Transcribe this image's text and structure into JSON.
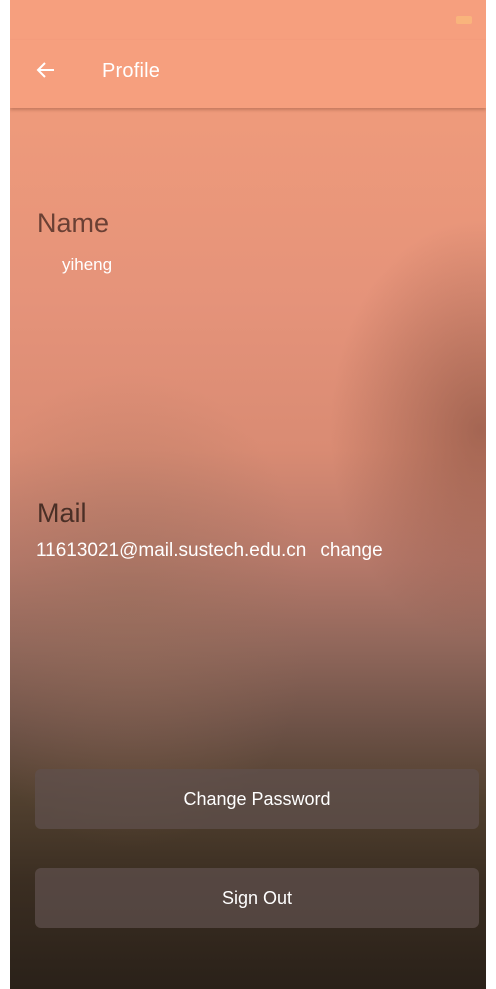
{
  "app_bar": {
    "title": "Profile",
    "back_icon": "arrow-left-icon"
  },
  "profile": {
    "name_label": "Name",
    "name_value": "yiheng",
    "mail_label": "Mail",
    "mail_value": "11613021@mail.sustech.edu.cn",
    "mail_change_label": "change"
  },
  "actions": {
    "change_password_label": "Change Password",
    "sign_out_label": "Sign Out"
  },
  "colors": {
    "app_bar": "#f69f7e",
    "label_text": "#6a4034",
    "value_text": "#ffffff",
    "button_bg": "#5f504e"
  }
}
